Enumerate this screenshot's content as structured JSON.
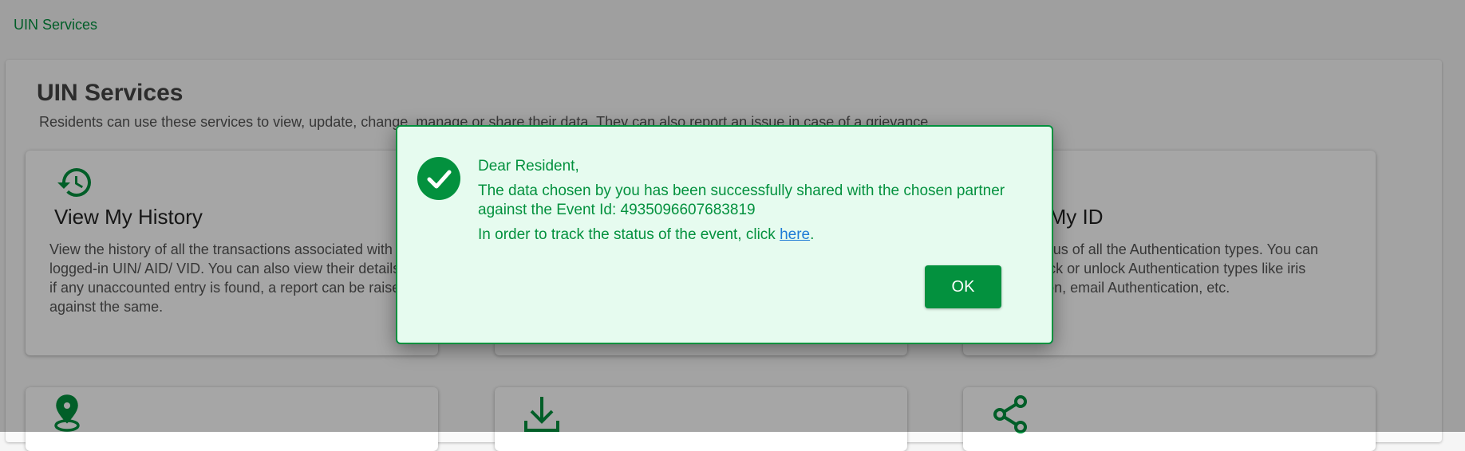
{
  "breadcrumb": "UIN Services",
  "page": {
    "title": "UIN Services",
    "description": "Residents can use these services to view, update, change, manage or share their data. They can also report an issue in case of a grievance."
  },
  "cards": [
    {
      "title": "View My History",
      "icon": "history-icon",
      "description": "View the history of all the transactions associated with your logged-in UIN/ AID/ VID. You can also view their details and if any unaccounted entry is found, a report can be raised against the same."
    },
    {
      "title": "",
      "icon": "",
      "description": ""
    },
    {
      "title": "Secure My ID",
      "icon": "",
      "description": "View the status of all the Authentication types. You can choose to lock or unlock Authentication types like iris Authentication, email Authentication, etc."
    },
    {
      "title": "",
      "icon": "location-pin-icon",
      "description": ""
    },
    {
      "title": "",
      "icon": "download-icon",
      "description": ""
    },
    {
      "title": "",
      "icon": "share-icon",
      "description": ""
    }
  ],
  "dialog": {
    "greeting": "Dear Resident,",
    "message": "The data chosen by you has been successfully shared with the chosen partner against the Event Id: 4935096607683819",
    "track_prefix": "In order to track the status of the event, click ",
    "track_link": "here",
    "track_suffix": ".",
    "ok_label": "OK",
    "icon": "success-check-icon"
  },
  "colors": {
    "accent": "#03913e",
    "dialog_bg": "#e6fbef",
    "link": "#1e7bd6"
  }
}
